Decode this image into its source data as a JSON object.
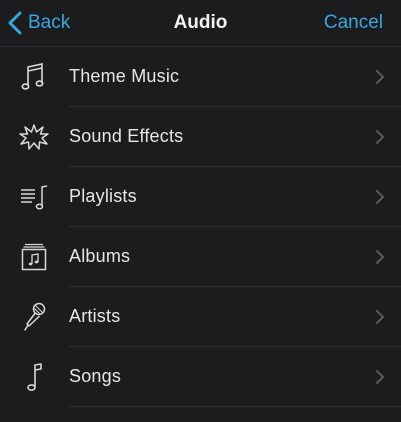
{
  "nav": {
    "back_label": "Back",
    "title": "Audio",
    "cancel_label": "Cancel"
  },
  "menu": {
    "items": [
      {
        "label": "Theme Music",
        "icon": "music-notes-icon"
      },
      {
        "label": "Sound Effects",
        "icon": "starburst-icon"
      },
      {
        "label": "Playlists",
        "icon": "playlist-icon"
      },
      {
        "label": "Albums",
        "icon": "album-icon"
      },
      {
        "label": "Artists",
        "icon": "microphone-icon"
      },
      {
        "label": "Songs",
        "icon": "music-note-icon"
      }
    ]
  },
  "colors": {
    "accent": "#35a8e0",
    "background": "#1c1c1e",
    "separator": "#2f2f31",
    "chevron": "#5a5a5e"
  }
}
